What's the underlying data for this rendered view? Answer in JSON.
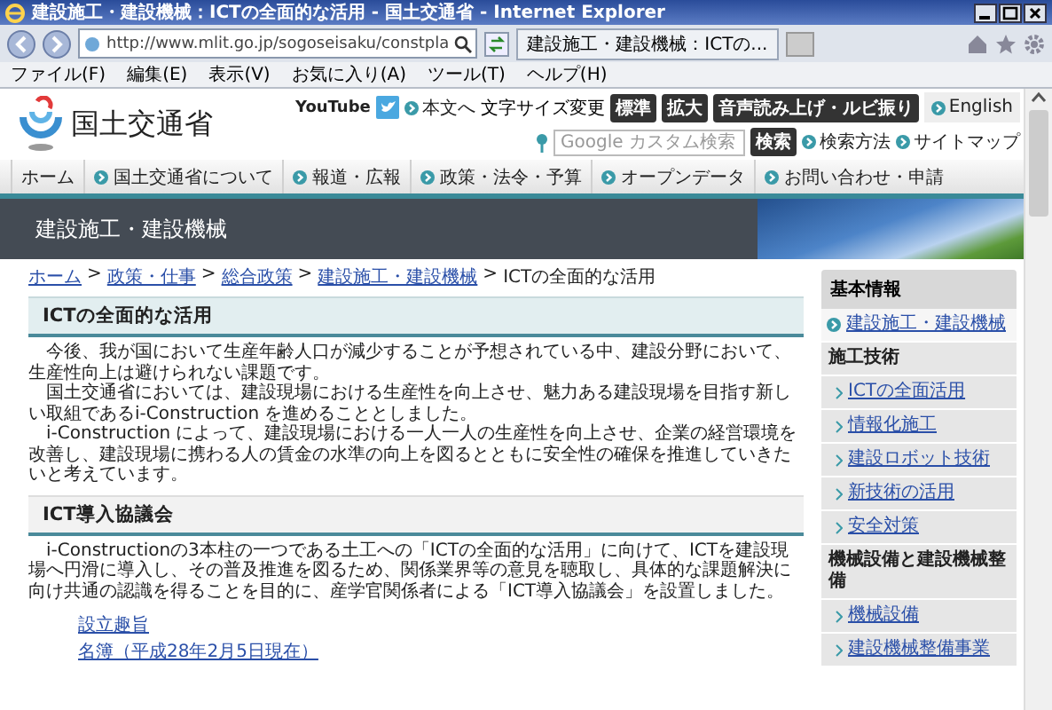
{
  "browser": {
    "title": "建設施工・建設機械：ICTの全面的な活用 - 国土交通省 - Internet Explorer",
    "address": "http://www.mlit.go.jp/sogoseisaku/constpla",
    "tab": "建設施工・建設機械：ICTの...",
    "menu": [
      "ファイル(F)",
      "編集(E)",
      "表示(V)",
      "お気に入り(A)",
      "ツール(T)",
      "ヘルプ(H)"
    ]
  },
  "header": {
    "logo": "国土交通省",
    "youtube": "YouTube",
    "skip_link": "本文へ",
    "text_size_label": "文字サイズ変更",
    "text_size_buttons": [
      "標準",
      "拡大"
    ],
    "read_aloud": "音声読み上げ・ルビ振り",
    "english": "English",
    "search": {
      "placeholder": "Google カスタム検索",
      "button": "検索"
    },
    "links": [
      "検索方法",
      "サイトマップ"
    ]
  },
  "nav": [
    {
      "label": "ホーム",
      "kind": "home"
    },
    {
      "label": "国土交通省について",
      "kind": "link"
    },
    {
      "label": "報道・広報",
      "kind": "link"
    },
    {
      "label": "政策・法令・予算",
      "kind": "link"
    },
    {
      "label": "オープンデータ",
      "kind": "link"
    },
    {
      "label": "お問い合わせ・申請",
      "kind": "link"
    }
  ],
  "banner": {
    "title": "建設施工・建設機械"
  },
  "breadcrumb": {
    "separator": ">",
    "items": [
      {
        "label": "ホーム",
        "kind": "link"
      },
      {
        "label": "政策・仕事",
        "kind": "link"
      },
      {
        "label": "総合政策",
        "kind": "link"
      },
      {
        "label": "建設施工・建設機械",
        "kind": "link"
      },
      {
        "label": "ICTの全面的な活用",
        "kind": "current"
      }
    ]
  },
  "sections": [
    {
      "heading": "ICTの全面的な活用",
      "kind": "primary",
      "paragraphs": [
        "今後、我が国において生産年齢人口が減少することが予想されている中、建設分野において、生産性向上は避けられない課題です。",
        "国土交通省においては、建設現場における生産性を向上させ、魅力ある建設現場を目指す新しい取組であるi-Construction を進めることとしました。",
        "i-Construction によって、建設現場における一人一人の生産性を向上させ、企業の経営環境を改善し、建設現場に携わる人の賃金の水準の向上を図るとともに安全性の確保を推進していきたいと考えています。"
      ]
    },
    {
      "heading": "ICT導入協議会",
      "kind": "secondary",
      "paragraphs": [
        "i-Constructionの3本柱の一つである土工への「ICTの全面的な活用」に向けて、ICTを建設現場へ円滑に導入し、その普及推進を図るため、関係業界等の意見を聴取し、具体的な課題解決に向け共通の認識を得ることを目的に、産学官関係者による「ICT導入協議会」を設置しました。"
      ],
      "links": [
        "設立趣旨",
        "名簿（平成28年2月5日現在）"
      ]
    }
  ],
  "sidebar": {
    "heading": "基本情報",
    "items": [
      {
        "label": "建設施工・建設機械",
        "kind": "current"
      },
      {
        "label": "施工技術",
        "kind": "category"
      },
      {
        "label": "ICTの全面活用",
        "kind": "link"
      },
      {
        "label": "情報化施工",
        "kind": "link"
      },
      {
        "label": "建設ロボット技術",
        "kind": "link"
      },
      {
        "label": "新技術の活用",
        "kind": "link"
      },
      {
        "label": "安全対策",
        "kind": "link"
      },
      {
        "label": "機械設備と建設機械整備",
        "kind": "category"
      },
      {
        "label": "機械設備",
        "kind": "link"
      },
      {
        "label": "建設機械整備事業",
        "kind": "link"
      }
    ]
  }
}
